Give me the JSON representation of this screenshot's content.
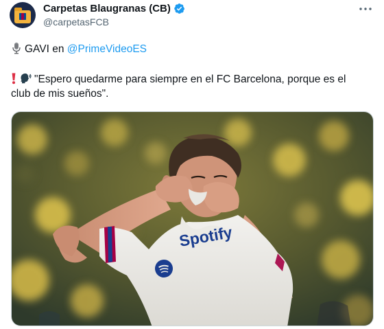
{
  "author": {
    "display_name": "Carpetas Blaugranas (CB)",
    "handle": "@carpetasFCB",
    "avatar_icon": "folder-icon",
    "verified_icon": "verified-badge-icon"
  },
  "menu": {
    "icon": "more-dots-icon"
  },
  "tweet": {
    "line1_prefix": "GAVI en ",
    "line1_mention": "@PrimeVideoES",
    "line2": "\"Espero quedarme para siempre en el FC Barcelona, porque es el",
    "line3": "club de mis sueños\".",
    "mic_icon": "microphone-icon",
    "exclamation_icon": "red-exclamation-icon",
    "speaking_icon": "speaking-head-icon"
  },
  "media": {
    "shirt_sponsor": "Spotify"
  },
  "colors": {
    "accent": "#1d9bf0",
    "text": "#0f1419",
    "muted": "#536471"
  }
}
